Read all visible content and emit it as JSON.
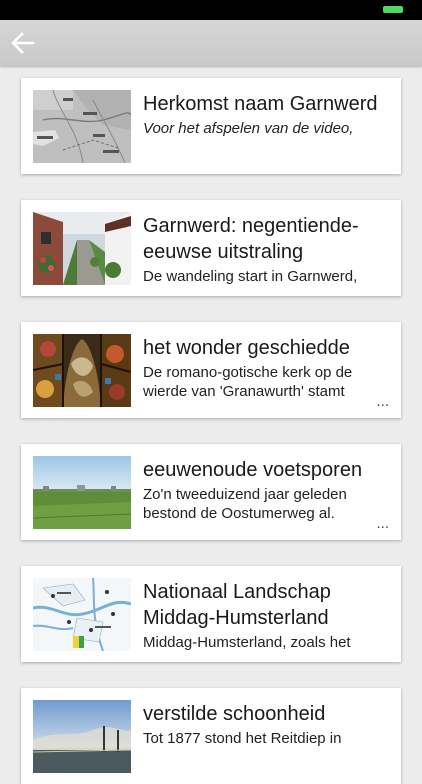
{
  "app_bar": {
    "back_icon": "arrow-left-icon"
  },
  "items": [
    {
      "title": "Herkomst naam Garnwerd",
      "description": "Voor het afspelen van de video,",
      "description_italic": true,
      "thumbnail": "map-thumbnail",
      "truncated": false
    },
    {
      "title": "Garnwerd: negentiende-eeuwse uitstraling",
      "description": "De wandeling start in Garnwerd,",
      "description_italic": false,
      "thumbnail": "village-alley-thumbnail",
      "truncated": false
    },
    {
      "title": "het wonder geschiedde",
      "description": "De romano-gotische kerk op de wierde van 'Granawurth' stamt",
      "description_italic": false,
      "thumbnail": "stained-glass-thumbnail",
      "truncated": true,
      "ellipsis": "..."
    },
    {
      "title": "eeuwenoude voetsporen",
      "description": "Zo'n tweeduizend jaar geleden bestond de Oostumerweg al.",
      "description_italic": false,
      "thumbnail": "meadow-thumbnail",
      "truncated": true,
      "ellipsis": "..."
    },
    {
      "title": "Nationaal Landschap Middag-Humsterland",
      "description": "Middag-Humsterland, zoals het",
      "description_italic": false,
      "thumbnail": "landscape-map-thumbnail",
      "truncated": false
    },
    {
      "title": "verstilde schoonheid",
      "description": "Tot 1877 stond het Reitdiep in",
      "description_italic": false,
      "thumbnail": "river-sky-thumbnail",
      "truncated": false
    }
  ],
  "colors": {
    "status_bar": "#000000",
    "battery": "#4cd964",
    "app_bar": "#cfcfcf",
    "background": "#ececec",
    "card": "#ffffff"
  }
}
